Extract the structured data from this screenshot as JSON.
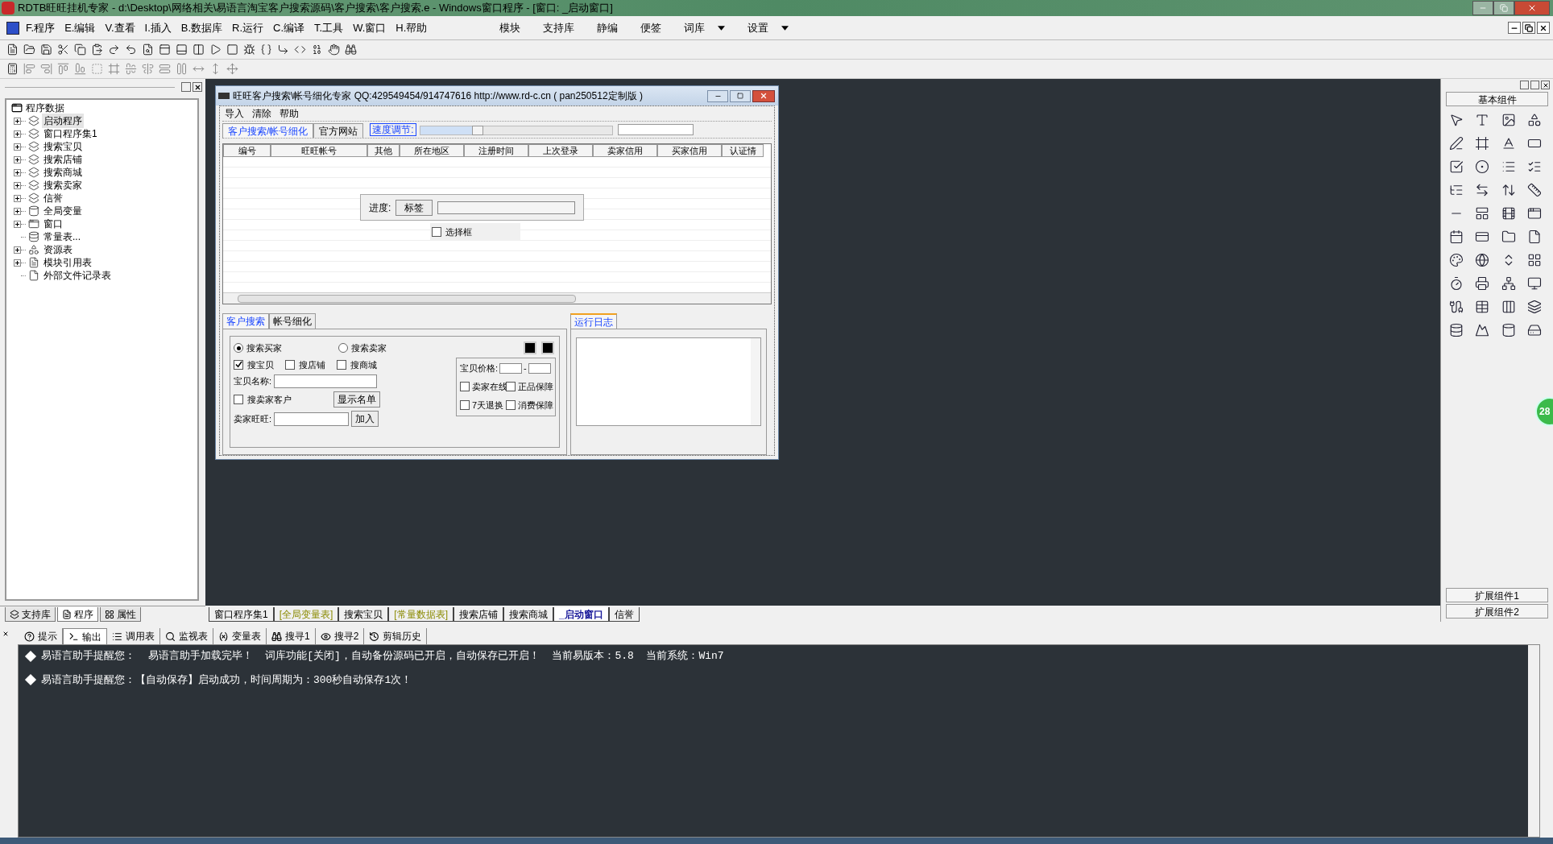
{
  "window": {
    "title": "RDTB旺旺挂机专家 - d:\\Desktop\\网络相关\\易语言淘宝客户搜索源码\\客户搜索\\客户搜索.e - Windows窗口程序 - [窗口: _启动窗口]"
  },
  "menu": [
    {
      "label": "F.程序"
    },
    {
      "label": "E.编辑"
    },
    {
      "label": "V.查看"
    },
    {
      "label": "I.插入"
    },
    {
      "label": "B.数据库"
    },
    {
      "label": "R.运行"
    },
    {
      "label": "C.编译"
    },
    {
      "label": "T.工具"
    },
    {
      "label": "W.窗口"
    },
    {
      "label": "H.帮助"
    }
  ],
  "menu_right": [
    {
      "label": "模块",
      "dropdown": false
    },
    {
      "label": "支持库",
      "dropdown": false
    },
    {
      "label": "静编",
      "dropdown": false
    },
    {
      "label": "便签",
      "dropdown": false
    },
    {
      "label": "词库",
      "dropdown": true
    },
    {
      "label": "设置",
      "dropdown": true
    }
  ],
  "tree": {
    "label": "程序数据",
    "children": [
      {
        "label": "启动程序",
        "kind": "module",
        "expandable": true,
        "selected": true
      },
      {
        "label": "窗口程序集1",
        "kind": "module",
        "expandable": true,
        "selected": false
      },
      {
        "label": "搜索宝贝",
        "kind": "module",
        "expandable": true,
        "selected": false
      },
      {
        "label": "搜索店铺",
        "kind": "module",
        "expandable": true,
        "selected": false
      },
      {
        "label": "搜索商城",
        "kind": "module",
        "expandable": true,
        "selected": false
      },
      {
        "label": "搜索卖家",
        "kind": "module",
        "expandable": true,
        "selected": false
      },
      {
        "label": "信誉",
        "kind": "module",
        "expandable": true,
        "selected": false
      },
      {
        "label": "全局变量",
        "kind": "variable",
        "expandable": true,
        "selected": false
      },
      {
        "label": "窗口",
        "kind": "window",
        "expandable": true,
        "selected": false
      },
      {
        "label": "常量表...",
        "kind": "constant",
        "expandable": false,
        "selected": false
      },
      {
        "label": "资源表",
        "kind": "resource",
        "expandable": true,
        "selected": false
      },
      {
        "label": "模块引用表",
        "kind": "module_ref",
        "expandable": true,
        "selected": false
      },
      {
        "label": "外部文件记录表",
        "kind": "file",
        "expandable": false,
        "selected": false
      }
    ]
  },
  "left_tabs": [
    {
      "label": "支持库",
      "selected": false
    },
    {
      "label": "程序",
      "selected": true
    },
    {
      "label": "属性",
      "selected": false
    }
  ],
  "doc_tabs": [
    {
      "label": "窗口程序集1",
      "kind": "code",
      "selected": false
    },
    {
      "label": "[全局变量表]",
      "kind": "table",
      "selected": false
    },
    {
      "label": "搜索宝贝",
      "kind": "code",
      "selected": false
    },
    {
      "label": "[常量数据表]",
      "kind": "table",
      "selected": false
    },
    {
      "label": "搜索店铺",
      "kind": "code",
      "selected": false
    },
    {
      "label": "搜索商城",
      "kind": "code",
      "selected": false
    },
    {
      "label": "_启动窗口",
      "kind": "code",
      "selected": true
    },
    {
      "label": "信誉",
      "kind": "code",
      "selected": false
    }
  ],
  "toolbox": {
    "title": "基本组件",
    "footer": [
      "扩展组件1",
      "扩展组件2"
    ]
  },
  "floating_badge": "28",
  "output_tabs": [
    {
      "label": "提示",
      "selected": false
    },
    {
      "label": "输出",
      "selected": true
    },
    {
      "label": "调用表",
      "selected": false
    },
    {
      "label": "监视表",
      "selected": false
    },
    {
      "label": "变量表",
      "selected": false
    },
    {
      "label": "搜寻1",
      "selected": false
    },
    {
      "label": "搜寻2",
      "selected": false
    },
    {
      "label": "剪辑历史",
      "selected": false
    }
  ],
  "output_lines": [
    "易语言助手提醒您：  易语言助手加载完毕！  词库功能[关闭]，自动备份源码已开启，自动保存已开启！  当前易版本：5.8  当前系统：Win7",
    "易语言助手提醒您：【自动保存】启动成功，时间周期为：300秒自动保存1次！"
  ],
  "form": {
    "title": "旺旺客户搜索\\帐号细化专家 QQ:429549454/914747616 http://www.rd-c.cn ( pan250512定制版 )",
    "menu": [
      "导入",
      "清除",
      "帮助"
    ],
    "tabs": [
      {
        "label": "客户搜索/帐号细化",
        "selected": true
      },
      {
        "label": "官方网站",
        "selected": false
      }
    ],
    "speed_label": "速度调节:",
    "speed": {
      "level": 0.3
    },
    "columns": [
      "编号",
      "旺旺帐号",
      "其他",
      "所在地区",
      "注册时间",
      "上次登录",
      "卖家信用",
      "买家信用",
      "认证情"
    ],
    "progress_label": "进度:",
    "progress_button": "标签",
    "progress": {
      "level": 0
    },
    "overlay_checkbox": {
      "label": "选择框",
      "checked": false
    },
    "search_tabs": [
      {
        "label": "客户搜索",
        "selected": true
      },
      {
        "label": "帐号细化",
        "selected": false
      }
    ],
    "radios": [
      {
        "label": "搜索买家",
        "selected": true
      },
      {
        "label": "搜索卖家",
        "selected": false
      }
    ],
    "scope": [
      {
        "label": "搜宝贝",
        "checked": true
      },
      {
        "label": "搜店铺",
        "checked": false
      },
      {
        "label": "搜商城",
        "checked": false
      }
    ],
    "item_name_label": "宝贝名称:",
    "seller_customers": {
      "label": "搜卖家客户",
      "checked": false
    },
    "show_list_button": "显示名单",
    "seller_label": "卖家旺旺:",
    "add_button": "加入",
    "price_label": "宝贝价格:",
    "price_dash": "-",
    "filters": [
      {
        "label": "卖家在线",
        "checked": false
      },
      {
        "label": "正品保障",
        "checked": false
      },
      {
        "label": "7天退换",
        "checked": false
      },
      {
        "label": "消费保障",
        "checked": false
      }
    ],
    "log_tab": {
      "label": "运行日志",
      "selected": true
    }
  }
}
